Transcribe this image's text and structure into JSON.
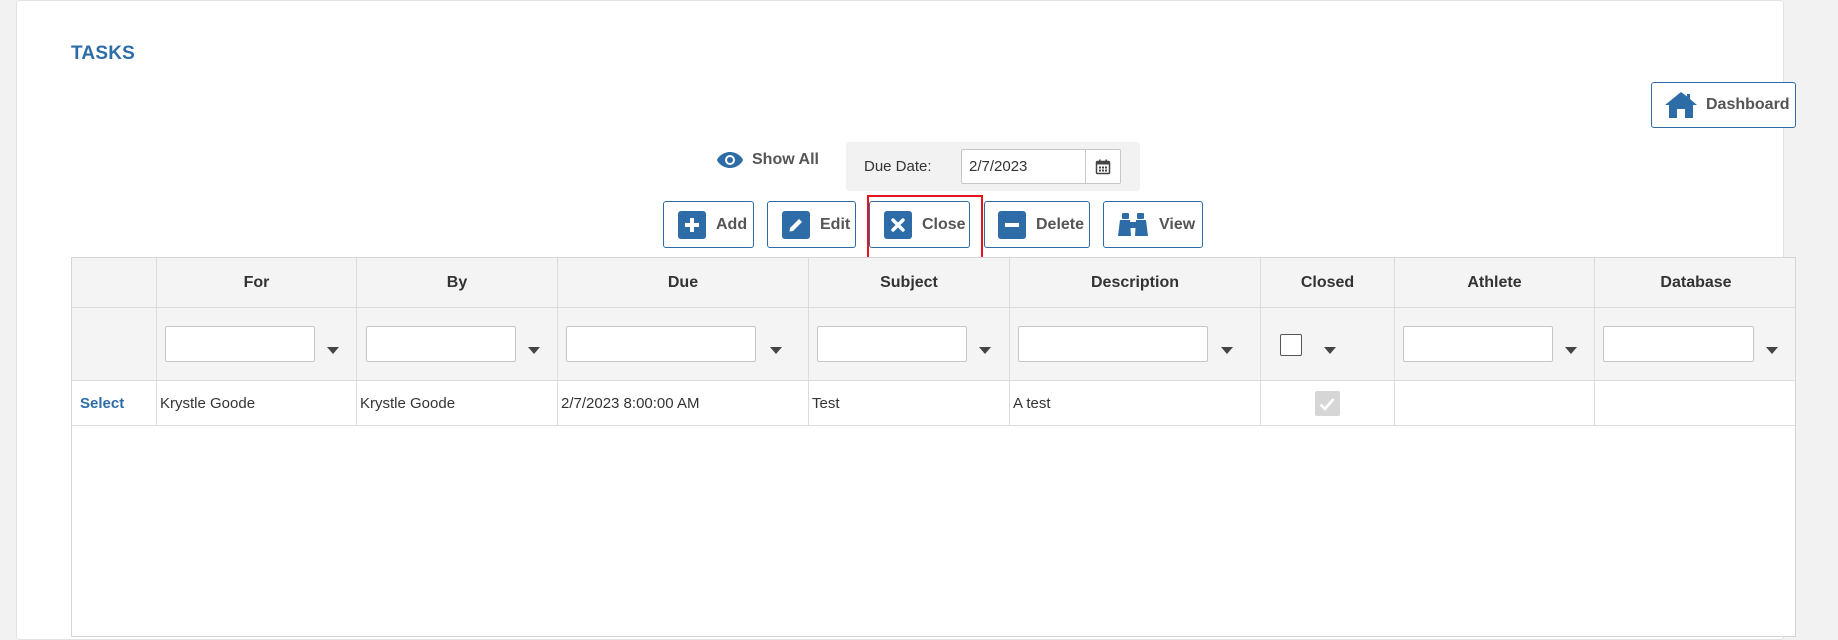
{
  "page": {
    "title": "TASKS"
  },
  "header": {
    "dashboard_label": "Dashboard"
  },
  "filters": {
    "show_all_label": "Show All",
    "due_date_label": "Due Date:",
    "due_date_value": "2/7/2023"
  },
  "toolbar": {
    "add_label": "Add",
    "edit_label": "Edit",
    "close_label": "Close",
    "delete_label": "Delete",
    "view_label": "View"
  },
  "grid": {
    "columns": [
      "",
      "For",
      "By",
      "Due",
      "Subject",
      "Description",
      "Closed",
      "Athlete",
      "Database"
    ],
    "rows": [
      {
        "action": "Select",
        "for": "Krystle Goode",
        "by": "Krystle Goode",
        "due": "2/7/2023 8:00:00 AM",
        "subject": "Test",
        "description": "A test",
        "closed": true,
        "athlete": "",
        "database": ""
      }
    ]
  },
  "colors": {
    "accent": "#2e6ca8",
    "highlight": "#e8131d",
    "header_bg": "#f4f4f4"
  },
  "icons": {
    "dashboard": "home-icon",
    "show_all": "eye-icon",
    "due_date": "calendar-icon",
    "add": "plus-icon",
    "edit": "pencil-icon",
    "close": "x-icon",
    "delete": "minus-icon",
    "view": "binoculars-icon"
  }
}
